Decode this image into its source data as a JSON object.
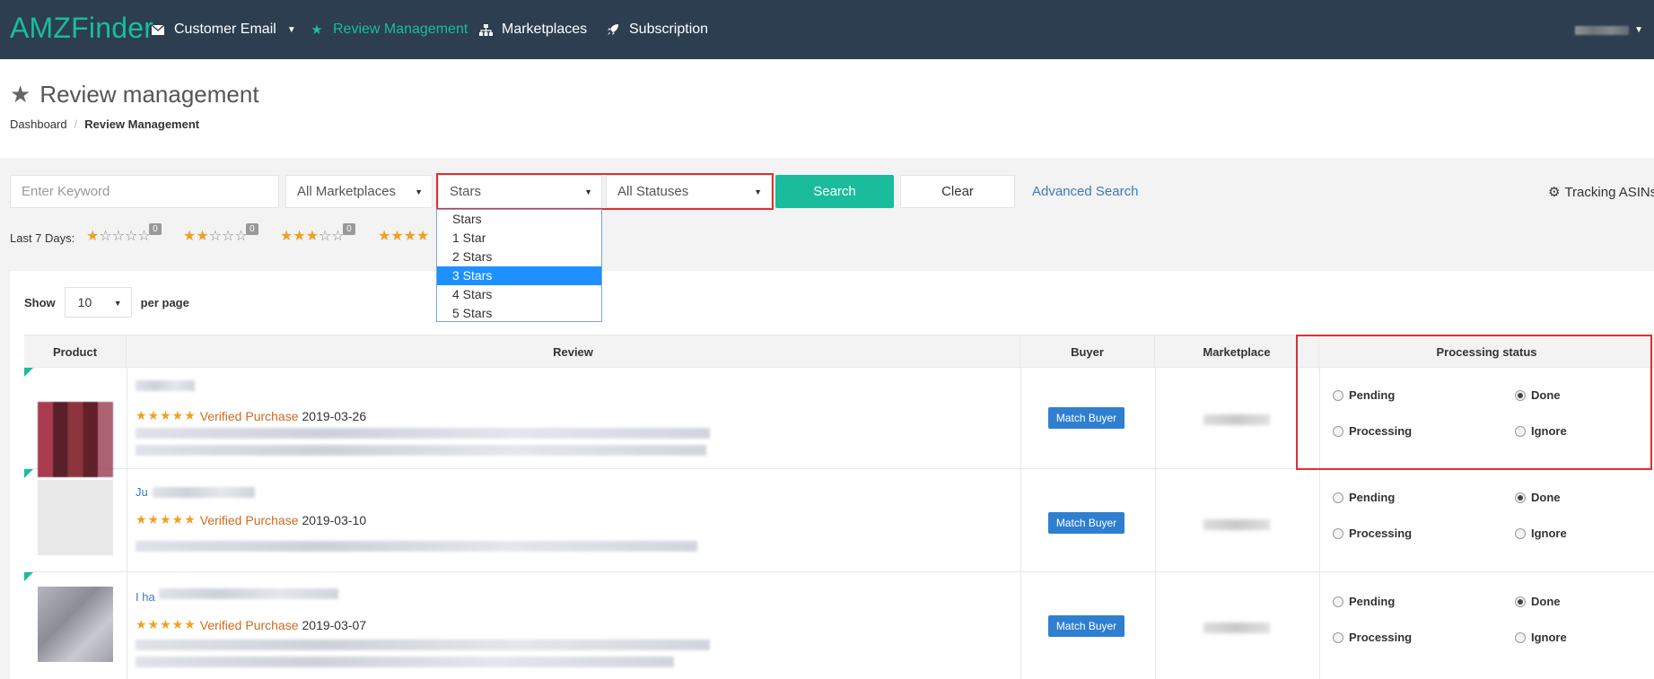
{
  "nav": {
    "brand": "AMZFinder",
    "items": [
      {
        "label": "Customer Email",
        "icon": "envelope-icon",
        "has_caret": true
      },
      {
        "label": "Review Management",
        "icon": "star-icon",
        "active": true
      },
      {
        "label": "Marketplaces",
        "icon": "sitemap-icon"
      },
      {
        "label": "Subscription",
        "icon": "rocket-icon"
      }
    ]
  },
  "page": {
    "title": "Review management",
    "breadcrumb": [
      "Dashboard",
      "Review Management"
    ]
  },
  "filters": {
    "keyword_placeholder": "Enter Keyword",
    "marketplace_value": "All Marketplaces",
    "stars_value": "Stars",
    "status_value": "All Statuses",
    "search_label": "Search",
    "clear_label": "Clear",
    "advanced_label": "Advanced Search",
    "tracking_label": "Tracking ASINs"
  },
  "stars_dropdown": {
    "options": [
      "Stars",
      "1 Star",
      "2 Stars",
      "3 Stars",
      "4 Stars",
      "5 Stars"
    ],
    "highlighted": "3 Stars"
  },
  "last7": {
    "label": "Last 7 Days:",
    "groups": [
      {
        "stars": 1,
        "count": "0"
      },
      {
        "stars": 2,
        "count": "0"
      },
      {
        "stars": 3,
        "count": "0"
      },
      {
        "stars": 4,
        "count": ""
      }
    ]
  },
  "pagination": {
    "show_label": "Show",
    "page_size": "10",
    "per_page_label": "per page"
  },
  "table": {
    "headers": [
      "Product",
      "Review",
      "Buyer",
      "Marketplace",
      "Processing status"
    ],
    "rows": [
      {
        "title_prefix": "",
        "verified": "Verified Purchase",
        "date": "2019-03-26",
        "stars": "★★★★★",
        "match_label": "Match Buyer",
        "status": "Done",
        "thumb": "dark"
      },
      {
        "title_prefix": "Ju",
        "verified": "Verified Purchase",
        "date": "2019-03-10",
        "stars": "★★★★★",
        "match_label": "Match Buyer",
        "status": "Done",
        "thumb": "light"
      },
      {
        "title_prefix": "I ha",
        "verified": "Verified Purchase",
        "date": "2019-03-07",
        "stars": "★★★★★",
        "match_label": "Match Buyer",
        "status": "Done",
        "thumb": "grey"
      }
    ],
    "status_options": [
      "Pending",
      "Done",
      "Processing",
      "Ignore"
    ]
  },
  "colors": {
    "nav_bg": "#2c3e50",
    "accent": "#1abc9c",
    "highlight_border": "#e03030",
    "link": "#3a7bbf",
    "star": "#f0a020"
  }
}
